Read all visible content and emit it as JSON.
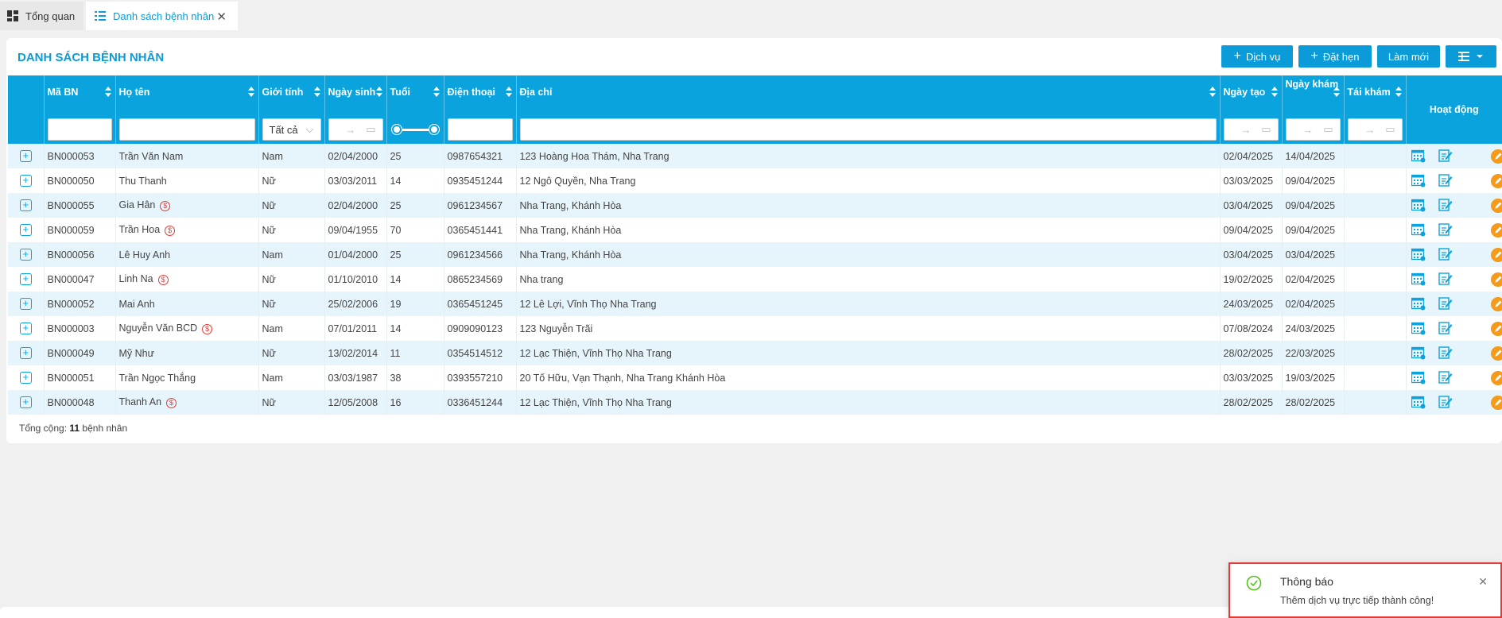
{
  "tabs": [
    {
      "label": "Tổng quan",
      "icon": "dashboard-icon"
    },
    {
      "label": "Danh sách bệnh nhân",
      "icon": "list-icon"
    }
  ],
  "page": {
    "title": "DANH SÁCH BỆNH NHÂN",
    "buttons": {
      "service": "Dịch vụ",
      "appointment": "Đặt hẹn",
      "refresh": "Làm mới"
    }
  },
  "table": {
    "headers": {
      "code": "Mã BN",
      "name": "Họ tên",
      "gender": "Giới tính",
      "dob": "Ngày sinh",
      "age": "Tuổi",
      "phone": "Điện thoại",
      "address": "Địa chỉ",
      "created": "Ngày tạo",
      "visit": "Ngày khám",
      "revisit": "Tái khám",
      "actions": "Hoạt động"
    },
    "filters": {
      "gender": "Tất cả",
      "date_sep": "→"
    },
    "rows": [
      {
        "code": "BN000053",
        "name": "Trần Văn Nam",
        "tag": false,
        "gender": "Nam",
        "dob": "02/04/2000",
        "age": "25",
        "phone": "0987654321",
        "address": "123 Hoàng Hoa Thám, Nha Trang",
        "created": "02/04/2025",
        "visit": "14/04/2025",
        "revisit": ""
      },
      {
        "code": "BN000050",
        "name": "Thu Thanh",
        "tag": false,
        "gender": "Nữ",
        "dob": "03/03/2011",
        "age": "14",
        "phone": "0935451244",
        "address": "12 Ngô Quyền, Nha Trang",
        "created": "03/03/2025",
        "visit": "09/04/2025",
        "revisit": ""
      },
      {
        "code": "BN000055",
        "name": "Gia Hân",
        "tag": true,
        "gender": "Nữ",
        "dob": "02/04/2000",
        "age": "25",
        "phone": "0961234567",
        "address": "Nha Trang, Khánh Hòa",
        "created": "03/04/2025",
        "visit": "09/04/2025",
        "revisit": ""
      },
      {
        "code": "BN000059",
        "name": "Trần Hoa",
        "tag": true,
        "gender": "Nữ",
        "dob": "09/04/1955",
        "age": "70",
        "phone": "0365451441",
        "address": "Nha Trang, Khánh Hòa",
        "created": "09/04/2025",
        "visit": "09/04/2025",
        "revisit": ""
      },
      {
        "code": "BN000056",
        "name": "Lê Huy Anh",
        "tag": false,
        "gender": "Nam",
        "dob": "01/04/2000",
        "age": "25",
        "phone": "0961234566",
        "address": "Nha Trang, Khánh Hòa",
        "created": "03/04/2025",
        "visit": "03/04/2025",
        "revisit": ""
      },
      {
        "code": "BN000047",
        "name": "Linh Na",
        "tag": true,
        "gender": "Nữ",
        "dob": "01/10/2010",
        "age": "14",
        "phone": "0865234569",
        "address": "Nha trang",
        "created": "19/02/2025",
        "visit": "02/04/2025",
        "revisit": ""
      },
      {
        "code": "BN000052",
        "name": "Mai Anh",
        "tag": false,
        "gender": "Nữ",
        "dob": "25/02/2006",
        "age": "19",
        "phone": "0365451245",
        "address": "12 Lê Lợi, Vĩnh Thọ Nha Trang",
        "created": "24/03/2025",
        "visit": "02/04/2025",
        "revisit": ""
      },
      {
        "code": "BN000003",
        "name": "Nguyễn Văn BCD",
        "tag": true,
        "gender": "Nam",
        "dob": "07/01/2011",
        "age": "14",
        "phone": "0909090123",
        "address": "123 Nguyễn Trãi",
        "created": "07/08/2024",
        "visit": "24/03/2025",
        "revisit": ""
      },
      {
        "code": "BN000049",
        "name": "Mỹ Như",
        "tag": false,
        "gender": "Nữ",
        "dob": "13/02/2014",
        "age": "11",
        "phone": "0354514512",
        "address": "12 Lạc Thiện, Vĩnh Thọ Nha Trang",
        "created": "28/02/2025",
        "visit": "22/03/2025",
        "revisit": ""
      },
      {
        "code": "BN000051",
        "name": "Trần Ngọc Thắng",
        "tag": false,
        "gender": "Nam",
        "dob": "03/03/1987",
        "age": "38",
        "phone": "0393557210",
        "address": "20 Tố Hữu, Vạn Thạnh, Nha Trang Khánh Hòa",
        "created": "03/03/2025",
        "visit": "19/03/2025",
        "revisit": ""
      },
      {
        "code": "BN000048",
        "name": "Thanh An",
        "tag": true,
        "gender": "Nữ",
        "dob": "12/05/2008",
        "age": "16",
        "phone": "0336451244",
        "address": "12 Lạc Thiện, Vĩnh Thọ Nha Trang",
        "created": "28/02/2025",
        "visit": "28/02/2025",
        "revisit": ""
      }
    ]
  },
  "footer": {
    "total_prefix": "Tổng cộng:",
    "total_count": "11",
    "total_suffix": "bệnh nhân"
  },
  "toast": {
    "title": "Thông báo",
    "message": "Thêm dịch vụ trực tiếp thành công!"
  },
  "colors": {
    "primary": "#0aa3de",
    "accent": "#f59a1b",
    "success": "#52c41a",
    "danger": "#e53935"
  }
}
